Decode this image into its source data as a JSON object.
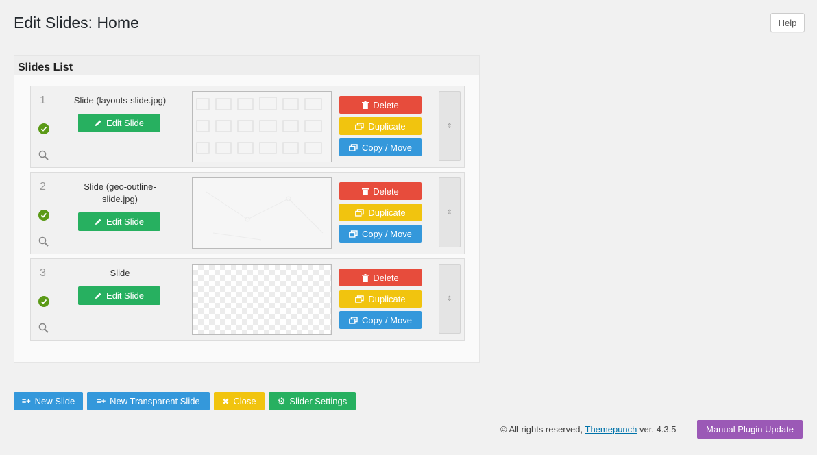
{
  "page": {
    "title": "Edit Slides: Home"
  },
  "help_label": "Help",
  "panel": {
    "title": "Slides List"
  },
  "slides": [
    {
      "number": "1",
      "name": "Slide (layouts-slide.jpg)",
      "edit_label": "Edit Slide",
      "delete_label": "Delete",
      "duplicate_label": "Duplicate",
      "copy_label": "Copy / Move"
    },
    {
      "number": "2",
      "name": "Slide (geo-outline-slide.jpg)",
      "edit_label": "Edit Slide",
      "delete_label": "Delete",
      "duplicate_label": "Duplicate",
      "copy_label": "Copy / Move"
    },
    {
      "number": "3",
      "name": "Slide",
      "edit_label": "Edit Slide",
      "delete_label": "Delete",
      "duplicate_label": "Duplicate",
      "copy_label": "Copy / Move"
    }
  ],
  "bottom": {
    "new_slide": "New Slide",
    "new_transparent": "New Transparent Slide",
    "close": "Close",
    "slider_settings": "Slider Settings"
  },
  "footer": {
    "prefix": "© All rights reserved, ",
    "link": "Themepunch",
    "suffix": " ver. 4.3.5",
    "update_label": "Manual Plugin Update"
  },
  "colors": {
    "edit": "#27b060",
    "delete": "#e74c3c",
    "duplicate": "#f1c40f",
    "copy": "#3498db",
    "update": "#9b59b6"
  },
  "icons": {
    "delete": "trash-icon",
    "duplicate": "duplicate-icon",
    "copy": "copy-move-icon",
    "edit": "pencil-icon",
    "status": "check-circle-icon",
    "preview": "magnifier-icon"
  }
}
